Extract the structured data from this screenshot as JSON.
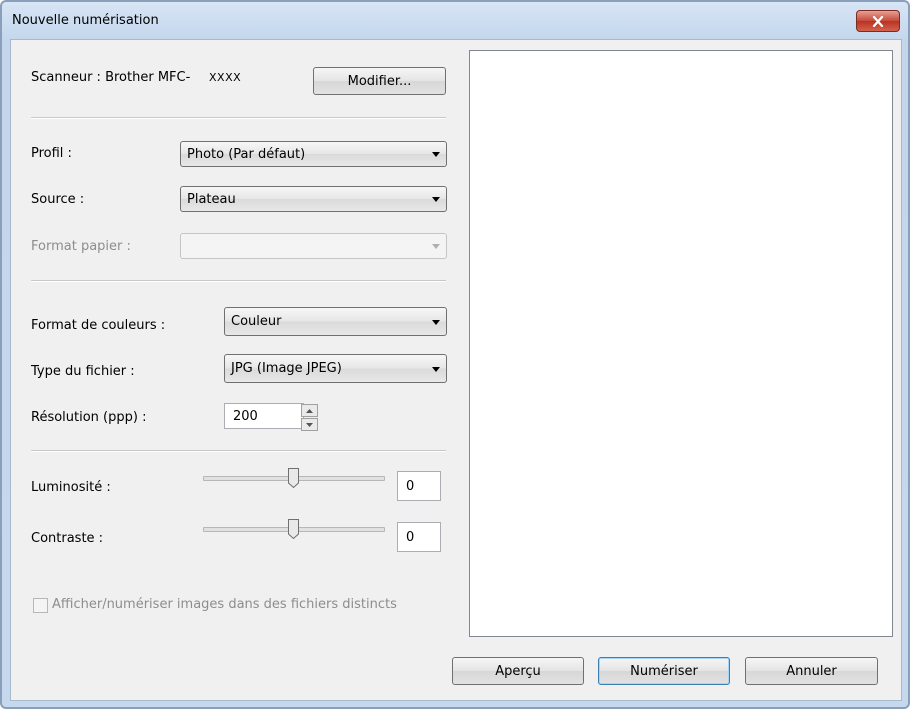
{
  "window": {
    "title": "Nouvelle numérisation"
  },
  "scanner": {
    "label": "Scanneur : Brother MFC-",
    "model": "XXXX",
    "modify_button": "Modifier..."
  },
  "profile": {
    "label": "Profil :",
    "value": "Photo (Par défaut)"
  },
  "source": {
    "label": "Source :",
    "value": "Plateau"
  },
  "paper_format": {
    "label": "Format papier :",
    "value": ""
  },
  "color_format": {
    "label": "Format de couleurs :",
    "value": "Couleur"
  },
  "file_type": {
    "label": "Type du fichier :",
    "value": "JPG (Image JPEG)"
  },
  "resolution": {
    "label": "Résolution (ppp) :",
    "value": "200"
  },
  "brightness": {
    "label": "Luminosité :",
    "value": "0",
    "level": 0.5
  },
  "contrast": {
    "label": "Contraste :",
    "value": "0",
    "level": 0.5
  },
  "separate_files": {
    "label": "Afficher/numériser images dans des fichiers distincts",
    "checked": false
  },
  "buttons": {
    "preview": "Aperçu",
    "scan": "Numériser",
    "cancel": "Annuler"
  }
}
